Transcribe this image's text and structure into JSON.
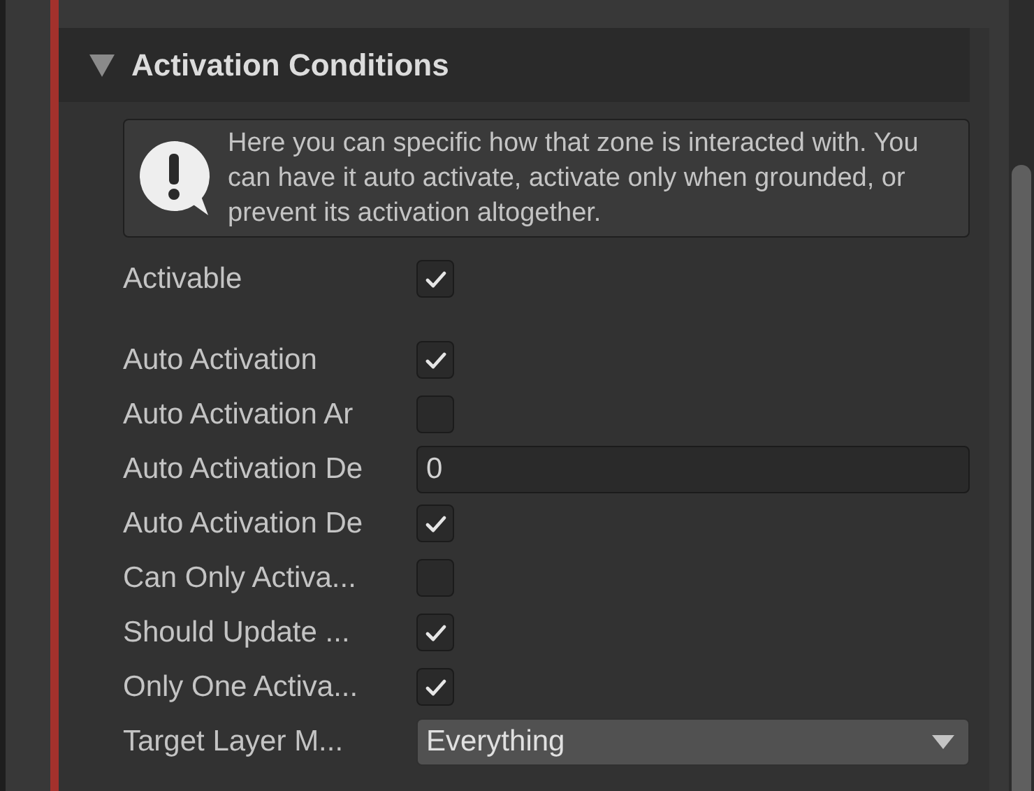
{
  "section": {
    "title": "Activation Conditions",
    "expanded": true,
    "help": "Here you can specific how that zone is interacted with. You can have it auto activate, activate only when grounded, or prevent its activation altogether.",
    "groups": [
      [
        {
          "label": "Activable",
          "kind": "checkbox",
          "checked": true
        }
      ],
      [
        {
          "label": "Auto Activation",
          "kind": "checkbox",
          "checked": true
        },
        {
          "label": "Auto Activation Ar",
          "kind": "checkbox",
          "checked": false
        },
        {
          "label": "Auto Activation De",
          "kind": "number",
          "value": "0"
        },
        {
          "label": "Auto Activation De",
          "kind": "checkbox",
          "checked": true
        },
        {
          "label": "Can Only Activa...",
          "kind": "checkbox",
          "checked": false
        },
        {
          "label": "Should Update ...",
          "kind": "checkbox",
          "checked": true
        },
        {
          "label": "Only One Activa...",
          "kind": "checkbox",
          "checked": true
        },
        {
          "label": "Target Layer M...",
          "kind": "dropdown",
          "value": "Everything"
        }
      ]
    ]
  }
}
